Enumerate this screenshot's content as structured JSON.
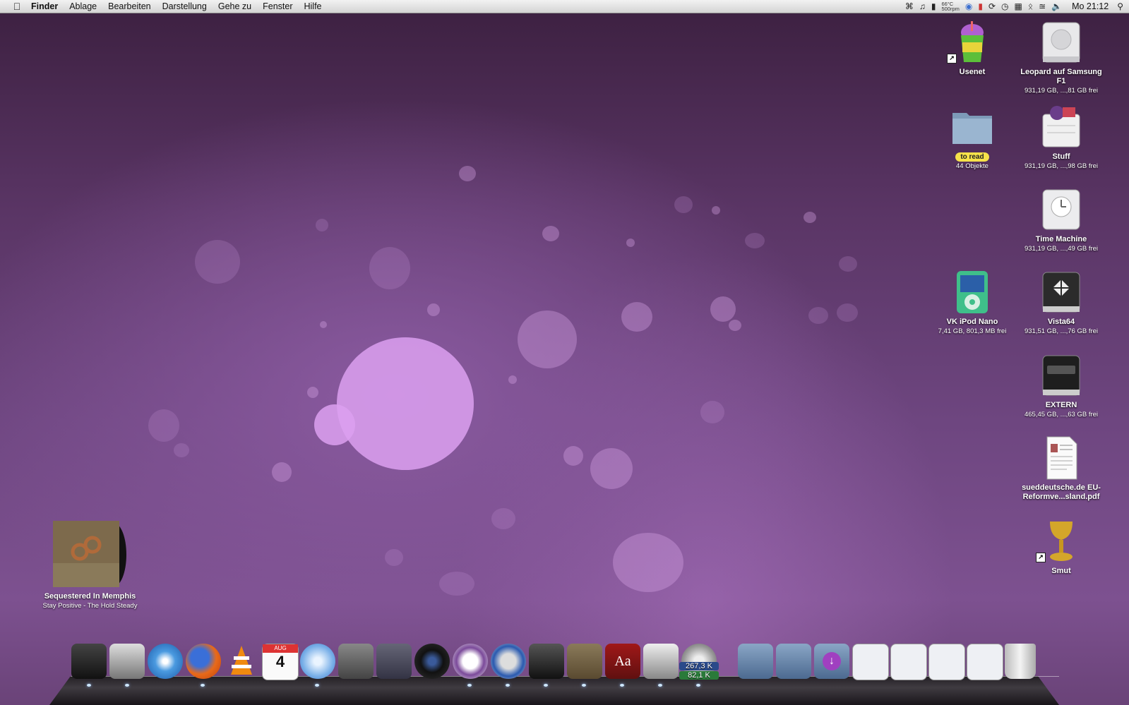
{
  "menubar": {
    "apple_icon": "apple-icon",
    "app_name": "Finder",
    "menus": [
      "Ablage",
      "Bearbeiten",
      "Darstellung",
      "Gehe zu",
      "Fenster",
      "Hilfe"
    ],
    "status": {
      "temp_line1": "66°C",
      "temp_line2": "500rpm",
      "clock": "Mo 21:12",
      "icons": [
        "command-icon",
        "music-note-icon",
        "dropbox-icon",
        "temperature-icon",
        "app-icon",
        "battery-meter-icon",
        "sync-icon",
        "time-machine-icon",
        "grid-icon",
        "bluetooth-icon",
        "wifi-icon",
        "volume-icon",
        "spotlight-icon"
      ]
    }
  },
  "desktop_icons": {
    "usenet": {
      "name": "Usenet"
    },
    "leopard": {
      "name": "Leopard auf Samsung F1",
      "sub": "931,19 GB, ...,81 GB frei"
    },
    "to_read": {
      "label": "to read",
      "sub": "44 Objekte"
    },
    "stuff": {
      "name": "Stuff",
      "sub": "931,19 GB, ...,98 GB frei"
    },
    "time_machine": {
      "name": "Time Machine",
      "sub": "931,19 GB, ...,49 GB frei"
    },
    "ipod": {
      "name": "VK iPod Nano",
      "sub": "7,41 GB, 801,3 MB frei"
    },
    "vista": {
      "name": "Vista64",
      "sub": "931,51 GB, ...,76 GB frei"
    },
    "extern": {
      "name": "EXTERN",
      "sub": "465,45 GB, ...,63 GB frei"
    },
    "pdf": {
      "name": "sueddeutsche.de EU-Reformve...sland.pdf"
    },
    "smut": {
      "name": "Smut"
    },
    "album": {
      "name": "Sequestered In Memphis",
      "sub": "Stay Positive - The Hold Steady"
    }
  },
  "dock": {
    "calendar_month": "AUG",
    "calendar_day": "4",
    "dictionary_glyph": "Aa",
    "net_down": "267,3 K",
    "net_up": "82,1 K",
    "items": [
      "disk-utility",
      "mail",
      "safari",
      "firefox",
      "vlc",
      "ical",
      "itunes",
      "system-preferences",
      "script-editor",
      "photo-booth",
      "adium",
      "network-utility",
      "frontrow",
      "album-art",
      "dictionary",
      "printer",
      "activity-monitor",
      "pictures-stack",
      "documents-stack",
      "downloads-stack",
      "window-1",
      "window-2",
      "window-3",
      "window-4",
      "trash"
    ]
  }
}
